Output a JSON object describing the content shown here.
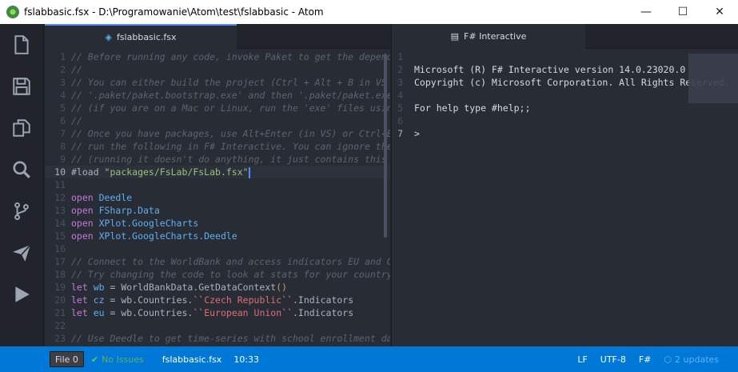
{
  "window": {
    "title": "fslabbasic.fsx - D:\\Programowanie\\Atom\\test\\fslabbasic - Atom",
    "controls": {
      "minimize": "—",
      "maximize": "☐",
      "close": "✕"
    }
  },
  "dock": {
    "items": [
      "file-icon",
      "save-icon",
      "copy-icon",
      "search-icon",
      "git-branch-icon",
      "send-icon",
      "run-icon"
    ]
  },
  "left_tab": {
    "icon": "◈",
    "label": "fslabbasic.fsx"
  },
  "right_tab": {
    "icon": "▤",
    "label": "F# Interactive"
  },
  "editor": {
    "lines": [
      {
        "n": "1",
        "parts": [
          {
            "t": "// Before running any code, invoke Paket to get the depend",
            "c": "comment"
          }
        ]
      },
      {
        "n": "2",
        "parts": [
          {
            "t": "//",
            "c": "comment"
          }
        ]
      },
      {
        "n": "3",
        "parts": [
          {
            "t": "// You can either build the project (Ctrl + Alt + B in VS",
            "c": "comment"
          }
        ]
      },
      {
        "n": "4",
        "parts": [
          {
            "t": "// '.paket/paket.bootstrap.exe' and then '.paket/paket.exe",
            "c": "comment"
          }
        ]
      },
      {
        "n": "5",
        "parts": [
          {
            "t": "// (if you are on a Mac or Linux, run the 'exe' files usin",
            "c": "comment"
          }
        ]
      },
      {
        "n": "6",
        "parts": [
          {
            "t": "//",
            "c": "comment"
          }
        ]
      },
      {
        "n": "7",
        "parts": [
          {
            "t": "// Once you have packages, use Alt+Enter (in VS) or Ctrl+E",
            "c": "comment"
          }
        ]
      },
      {
        "n": "8",
        "parts": [
          {
            "t": "// run the following in F# Interactive. You can ignore the",
            "c": "comment"
          }
        ]
      },
      {
        "n": "9",
        "parts": [
          {
            "t": "// (running it doesn't do anything, it just contains this",
            "c": "comment"
          }
        ]
      },
      {
        "n": "10",
        "cur": true,
        "parts": [
          {
            "t": "#load ",
            "c": "plain"
          },
          {
            "t": "\"packages/FsLab/FsLab.fsx\"",
            "c": "str"
          }
        ]
      },
      {
        "n": "11",
        "parts": []
      },
      {
        "n": "12",
        "parts": [
          {
            "t": "open ",
            "c": "kw"
          },
          {
            "t": "Deedle",
            "c": "type"
          }
        ]
      },
      {
        "n": "13",
        "parts": [
          {
            "t": "open ",
            "c": "kw"
          },
          {
            "t": "FSharp.Data",
            "c": "type"
          }
        ]
      },
      {
        "n": "14",
        "parts": [
          {
            "t": "open ",
            "c": "kw"
          },
          {
            "t": "XPlot.GoogleCharts",
            "c": "type"
          }
        ]
      },
      {
        "n": "15",
        "parts": [
          {
            "t": "open ",
            "c": "kw"
          },
          {
            "t": "XPlot.GoogleCharts.Deedle",
            "c": "type"
          }
        ]
      },
      {
        "n": "16",
        "parts": []
      },
      {
        "n": "17",
        "parts": [
          {
            "t": "// Connect to the WorldBank and access indicators EU and C",
            "c": "comment"
          }
        ]
      },
      {
        "n": "18",
        "parts": [
          {
            "t": "// Try changing the code to look at stats for your country",
            "c": "comment"
          }
        ]
      },
      {
        "n": "19",
        "parts": [
          {
            "t": "let ",
            "c": "kw"
          },
          {
            "t": "wb",
            "c": "type"
          },
          {
            "t": " = WorldBankData.GetDataContext",
            "c": "plain"
          },
          {
            "t": "()",
            "c": "punct"
          }
        ]
      },
      {
        "n": "20",
        "parts": [
          {
            "t": "let ",
            "c": "kw"
          },
          {
            "t": "cz",
            "c": "type"
          },
          {
            "t": " = wb.Countries.",
            "c": "plain"
          },
          {
            "t": "``",
            "c": "punct"
          },
          {
            "t": "Czech Republic",
            "c": "ident"
          },
          {
            "t": "``",
            "c": "punct"
          },
          {
            "t": ".Indicators",
            "c": "plain"
          }
        ]
      },
      {
        "n": "21",
        "parts": [
          {
            "t": "let ",
            "c": "kw"
          },
          {
            "t": "eu",
            "c": "type"
          },
          {
            "t": " = wb.Countries.",
            "c": "plain"
          },
          {
            "t": "``",
            "c": "punct"
          },
          {
            "t": "European Union",
            "c": "ident"
          },
          {
            "t": "``",
            "c": "punct"
          },
          {
            "t": ".Indicators",
            "c": "plain"
          }
        ]
      },
      {
        "n": "22",
        "parts": []
      },
      {
        "n": "23",
        "parts": [
          {
            "t": "// Use Deedle to get time-series with school enrollment da",
            "c": "comment"
          }
        ]
      }
    ]
  },
  "repl": {
    "lines": [
      {
        "n": "1",
        "text": ""
      },
      {
        "n": "2",
        "text": "Microsoft (R) F# Interactive version 14.0.23020.0"
      },
      {
        "n": "3",
        "text": "Copyright (c) Microsoft Corporation. All Rights Reserved."
      },
      {
        "n": "4",
        "text": ""
      },
      {
        "n": "5",
        "text": "For help type #help;;"
      },
      {
        "n": "6",
        "text": ""
      },
      {
        "n": "7",
        "text": ">",
        "cur": true
      }
    ]
  },
  "status": {
    "file_count": "File 0",
    "issues_icon": "✔",
    "issues": "No Issues",
    "filename": "fslabbasic.fsx",
    "position": "10:33",
    "line_ending": "LF",
    "encoding": "UTF-8",
    "grammar": "F#",
    "updates_icon": "⬡",
    "updates": "2 updates"
  }
}
